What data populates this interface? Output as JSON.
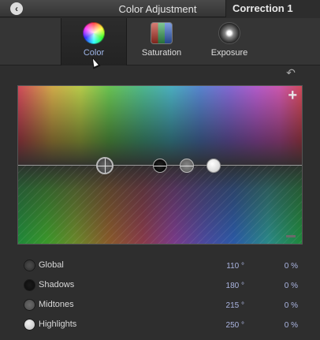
{
  "window": {
    "title": "Color Adjustment",
    "correction_label": "Correction 1"
  },
  "tabs": [
    {
      "label": "Color",
      "icon": "color-wheel-icon",
      "active": true
    },
    {
      "label": "Saturation",
      "icon": "saturation-icon",
      "active": false
    },
    {
      "label": "Exposure",
      "icon": "exposure-icon",
      "active": false
    }
  ],
  "board": {
    "add_icon": "plus-icon",
    "reset_icon": "reset-icon"
  },
  "controls": [
    {
      "label": "Global",
      "angle": "110 °",
      "percent": "0 %"
    },
    {
      "label": "Shadows",
      "angle": "180 °",
      "percent": "0 %"
    },
    {
      "label": "Midtones",
      "angle": "215 °",
      "percent": "0 %"
    },
    {
      "label": "Highlights",
      "angle": "250 °",
      "percent": "0 %"
    }
  ]
}
